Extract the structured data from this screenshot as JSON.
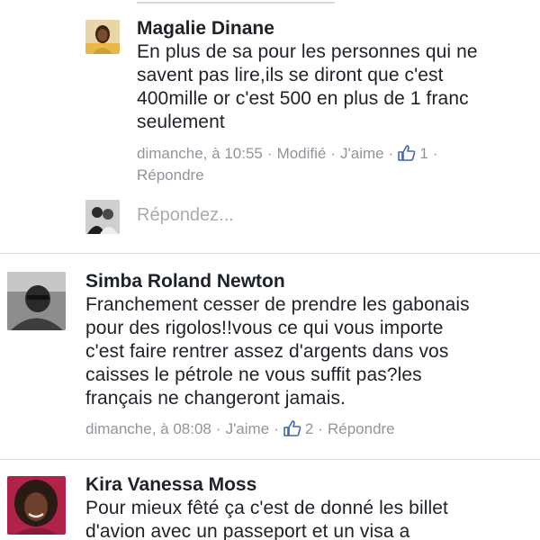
{
  "comments": [
    {
      "name": "Magalie Dinane",
      "lines": [
        "En plus de sa pour les personnes qui ne",
        "savent pas lire,ils se diront que c'est",
        "400mille or c'est 500 en plus de 1 franc",
        "seulement"
      ],
      "time": "dimanche, à 10:55",
      "edited": "Modifié",
      "like_label": "J'aime",
      "like_count": "1",
      "reply_label": "Répondre",
      "avatar_icon": "user-photo-woman-icon"
    },
    {
      "name": "Simba Roland Newton",
      "lines": [
        "Franchement cesser de prendre les gabonais",
        "pour des rigolos!!vous ce qui vous importe",
        "c'est faire rentrer assez d'argents dans vos",
        "caisses le pétrole ne vous suffit pas?les",
        "français ne changeront jamais."
      ],
      "time": "dimanche, à 08:08",
      "like_label": "J'aime",
      "like_count": "2",
      "reply_label": "Répondre",
      "avatar_icon": "user-photo-man-icon"
    },
    {
      "name": "Kira Vanessa Moss",
      "lines": [
        "Pour mieux fêté ça c'est de donné les billet",
        "d'avion  avec un passeport et un visa a"
      ],
      "avatar_icon": "user-photo-woman-icon"
    }
  ],
  "reply_box": {
    "placeholder": "Répondez...",
    "avatar_icon": "user-photo-couple-icon"
  },
  "colors": {
    "text": "#1d2129",
    "meta": "#90949c",
    "like_blue": "#4267b2",
    "separator": "#dddfe2",
    "placeholder": "#a7abb2"
  }
}
